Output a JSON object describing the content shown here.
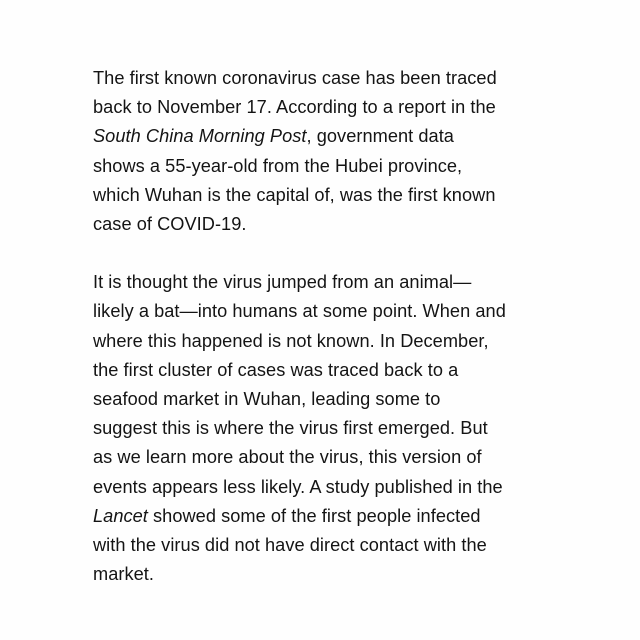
{
  "article": {
    "paragraphs": [
      {
        "lines": [
          [
            {
              "text": "The first known coronavirus case has been traced"
            }
          ],
          [
            {
              "text": "back to November 17. According to a report in the"
            }
          ],
          [
            {
              "text": "South China Morning Post",
              "italic": true
            },
            {
              "text": ", government data"
            }
          ],
          [
            {
              "text": "shows a 55-year-old from the Hubei province,"
            }
          ],
          [
            {
              "text": "which Wuhan is the capital of, was the first known"
            }
          ],
          [
            {
              "text": "case of COVID-19."
            }
          ]
        ]
      },
      {
        "lines": [
          [
            {
              "text": "It is thought the virus jumped from an animal—"
            }
          ],
          [
            {
              "text": "likely a bat—into humans at some point. When and"
            }
          ],
          [
            {
              "text": "where this happened is not known. In December,"
            }
          ],
          [
            {
              "text": "the first cluster of cases was traced back to a"
            }
          ],
          [
            {
              "text": "seafood market in Wuhan, leading some to"
            }
          ],
          [
            {
              "text": "suggest this is where the virus first emerged. But"
            }
          ],
          [
            {
              "text": "as we learn more about the virus, this version of"
            }
          ],
          [
            {
              "text": "events appears less likely. A study published in the"
            }
          ],
          [
            {
              "text": "Lancet",
              "italic": true
            },
            {
              "text": " showed some of the first people infected"
            }
          ],
          [
            {
              "text": "with the virus did not have direct contact with the"
            }
          ],
          [
            {
              "text": "market."
            }
          ]
        ]
      }
    ]
  }
}
